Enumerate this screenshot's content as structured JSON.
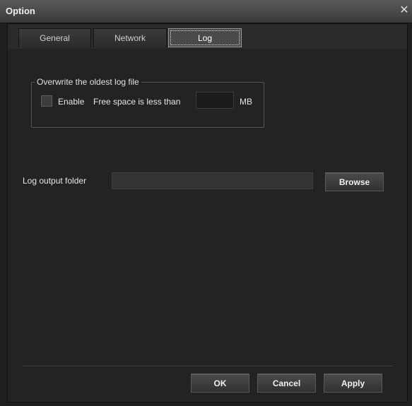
{
  "window": {
    "title": "Option",
    "close_glyph": "✕"
  },
  "tabs": [
    {
      "label": "General",
      "selected": false
    },
    {
      "label": "Network",
      "selected": false
    },
    {
      "label": "Log",
      "selected": true
    }
  ],
  "overwrite_group": {
    "legend": "Overwrite the oldest log file",
    "enable_label": "Enable",
    "enable_checked": false,
    "free_space_label": "Free space is less than",
    "mb_value": "",
    "unit": "MB"
  },
  "log_output": {
    "label": "Log output folder",
    "value": "",
    "browse_label": "Browse"
  },
  "footer": {
    "ok_label": "OK",
    "cancel_label": "Cancel",
    "apply_label": "Apply"
  },
  "colors": {
    "background": "#1f1f1f",
    "panel": "#232323",
    "titlebar": "#4a4a4a",
    "text": "#e6e6e6"
  },
  "icons": {
    "close": "close-icon",
    "checkbox": "checkbox-unchecked"
  }
}
